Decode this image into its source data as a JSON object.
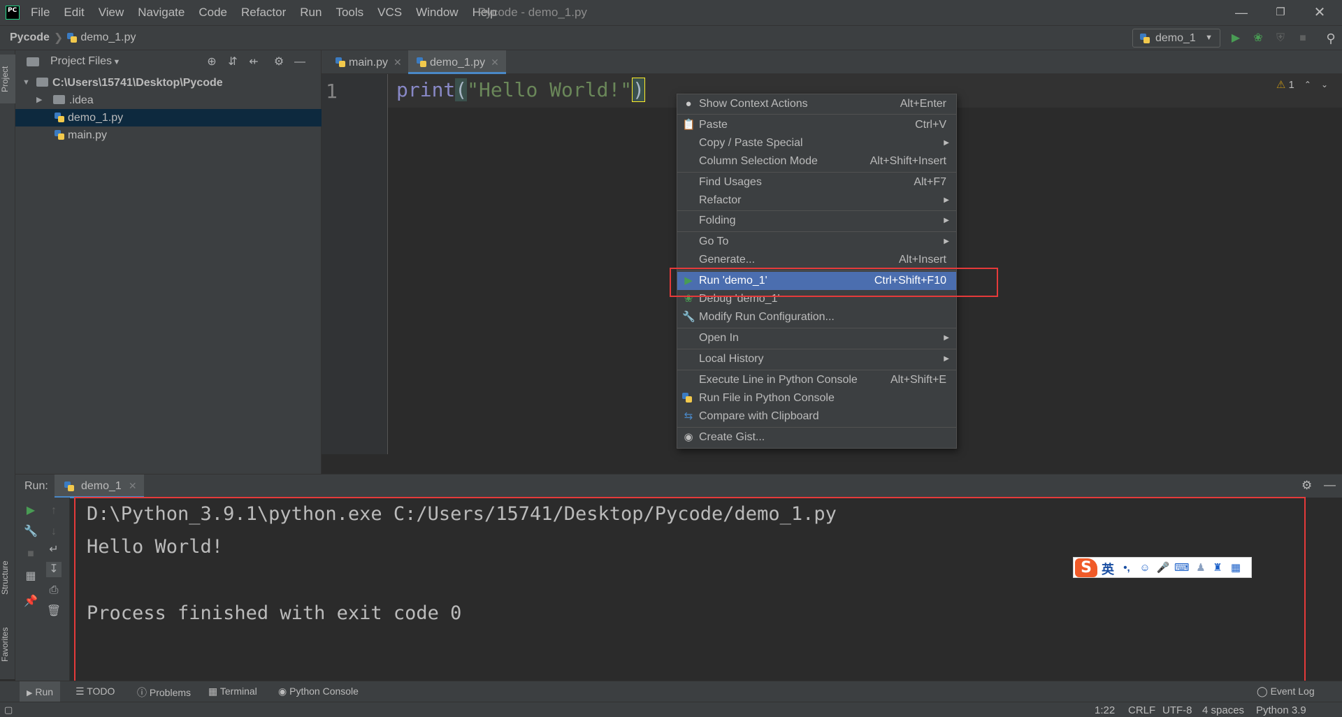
{
  "menubar": {
    "logo_text": "PC",
    "items": [
      "File",
      "Edit",
      "View",
      "Navigate",
      "Code",
      "Refactor",
      "Run",
      "Tools",
      "VCS",
      "Window",
      "Help"
    ],
    "window_title": "Pycode - demo_1.py"
  },
  "navbar": {
    "project": "Pycode",
    "file": "demo_1.py",
    "run_config": "demo_1"
  },
  "left_stripe": {
    "project_tab": "Project",
    "structure_tab": "Structure",
    "favorites_tab": "Favorites"
  },
  "project_panel": {
    "title": "Project Files",
    "tree": [
      {
        "label": "C:\\Users\\15741\\Desktop\\Pycode",
        "type": "folder",
        "expanded": true
      },
      {
        "label": ".idea",
        "type": "folder",
        "expanded": false
      },
      {
        "label": "demo_1.py",
        "type": "python",
        "selected": true
      },
      {
        "label": "main.py",
        "type": "python"
      }
    ]
  },
  "editor": {
    "tabs": [
      {
        "label": "main.py",
        "active": false
      },
      {
        "label": "demo_1.py",
        "active": true
      }
    ],
    "line_number": "1",
    "code": {
      "func": "print",
      "open": "(",
      "string": "\"Hello World!\"",
      "close": ")"
    },
    "inspection_count": "1"
  },
  "context_menu": {
    "items": [
      {
        "label": "Show Context Actions",
        "shortcut": "Alt+Enter",
        "icon": "bulb-icon"
      },
      {
        "label": "Paste",
        "shortcut": "Ctrl+V",
        "icon": "paste-icon"
      },
      {
        "label": "Copy / Paste Special",
        "shortcut": "",
        "submenu": true
      },
      {
        "label": "Column Selection Mode",
        "shortcut": "Alt+Shift+Insert"
      },
      {
        "label": "Find Usages",
        "shortcut": "Alt+F7"
      },
      {
        "label": "Refactor",
        "shortcut": "",
        "submenu": true
      },
      {
        "label": "Folding",
        "shortcut": "",
        "submenu": true
      },
      {
        "label": "Go To",
        "shortcut": "",
        "submenu": true
      },
      {
        "label": "Generate...",
        "shortcut": "Alt+Insert"
      },
      {
        "label": "Run 'demo_1'",
        "shortcut": "Ctrl+Shift+F10",
        "icon": "run-icon",
        "highlight": true
      },
      {
        "label": "Debug 'demo_1'",
        "shortcut": "",
        "icon": "debug-icon"
      },
      {
        "label": "Modify Run Configuration...",
        "shortcut": "",
        "icon": "wrench-icon"
      },
      {
        "label": "Open In",
        "shortcut": "",
        "submenu": true
      },
      {
        "label": "Local History",
        "shortcut": "",
        "submenu": true
      },
      {
        "label": "Execute Line in Python Console",
        "shortcut": "Alt+Shift+E"
      },
      {
        "label": "Run File in Python Console",
        "shortcut": "",
        "icon": "python-icon"
      },
      {
        "label": "Compare with Clipboard",
        "shortcut": "",
        "icon": "compare-icon"
      },
      {
        "label": "Create Gist...",
        "shortcut": "",
        "icon": "github-icon"
      }
    ]
  },
  "run_window": {
    "label": "Run:",
    "tab": "demo_1",
    "console": [
      "D:\\Python_3.9.1\\python.exe C:/Users/15741/Desktop/Pycode/demo_1.py",
      "Hello World!",
      "",
      "Process finished with exit code 0"
    ]
  },
  "ime_bar": {
    "mode": "英",
    "punct": "•,"
  },
  "bottom_tools": {
    "run": "Run",
    "todo": "TODO",
    "problems": "Problems",
    "terminal": "Terminal",
    "python_console": "Python Console",
    "event_log": "Event Log"
  },
  "status_bar": {
    "position": "1:22",
    "line_sep": "CRLF",
    "encoding": "UTF-8",
    "indent": "4 spaces",
    "interpreter": "Python 3.9"
  },
  "colors": {
    "highlight": "#4b6eaf",
    "annotation_box": "#e53a3a",
    "run_green": "#499c54"
  }
}
